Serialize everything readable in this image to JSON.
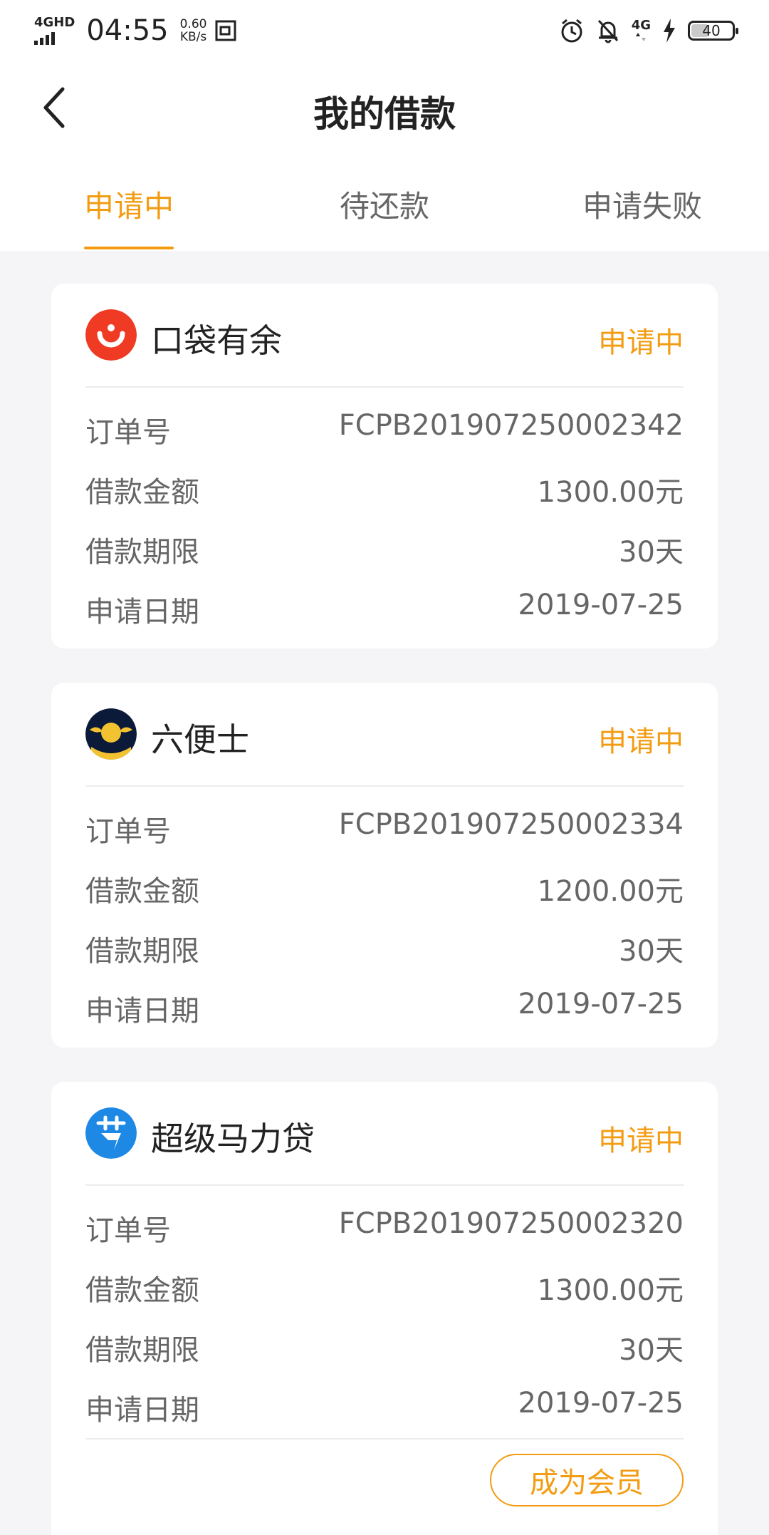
{
  "status_bar": {
    "network_left": "4GHD",
    "time": "04:55",
    "speed_value": "0.60",
    "speed_unit": "KB/s",
    "network_right": "4G",
    "battery": "40"
  },
  "header": {
    "title": "我的借款"
  },
  "tabs": [
    {
      "label": "申请中",
      "active": true
    },
    {
      "label": "待还款",
      "active": false
    },
    {
      "label": "申请失败",
      "active": false
    }
  ],
  "field_labels": {
    "order_no": "订单号",
    "amount": "借款金额",
    "term": "借款期限",
    "date": "申请日期"
  },
  "loans": [
    {
      "platform": "口袋有余",
      "status": "申请中",
      "order_no": "FCPB201907250002342",
      "amount": "1300.00元",
      "term": "30天",
      "date": "2019-07-25"
    },
    {
      "platform": "六便士",
      "status": "申请中",
      "order_no": "FCPB201907250002334",
      "amount": "1200.00元",
      "term": "30天",
      "date": "2019-07-25"
    },
    {
      "platform": "超级马力贷",
      "status": "申请中",
      "order_no": "FCPB201907250002320",
      "amount": "1300.00元",
      "term": "30天",
      "date": "2019-07-25",
      "action_label": "成为会员"
    }
  ],
  "colors": {
    "accent": "#f39c12",
    "background": "#f5f5f7",
    "text_primary": "#222222",
    "text_secondary": "#666666"
  },
  "icons": {
    "back": "chevron-left-icon",
    "alarm": "alarm-icon",
    "mute": "bell-off-icon",
    "charging": "lightning-icon",
    "logo_1": "koudai-logo-icon",
    "logo_2": "coin-wings-logo-icon",
    "logo_3": "dai-logo-icon"
  }
}
